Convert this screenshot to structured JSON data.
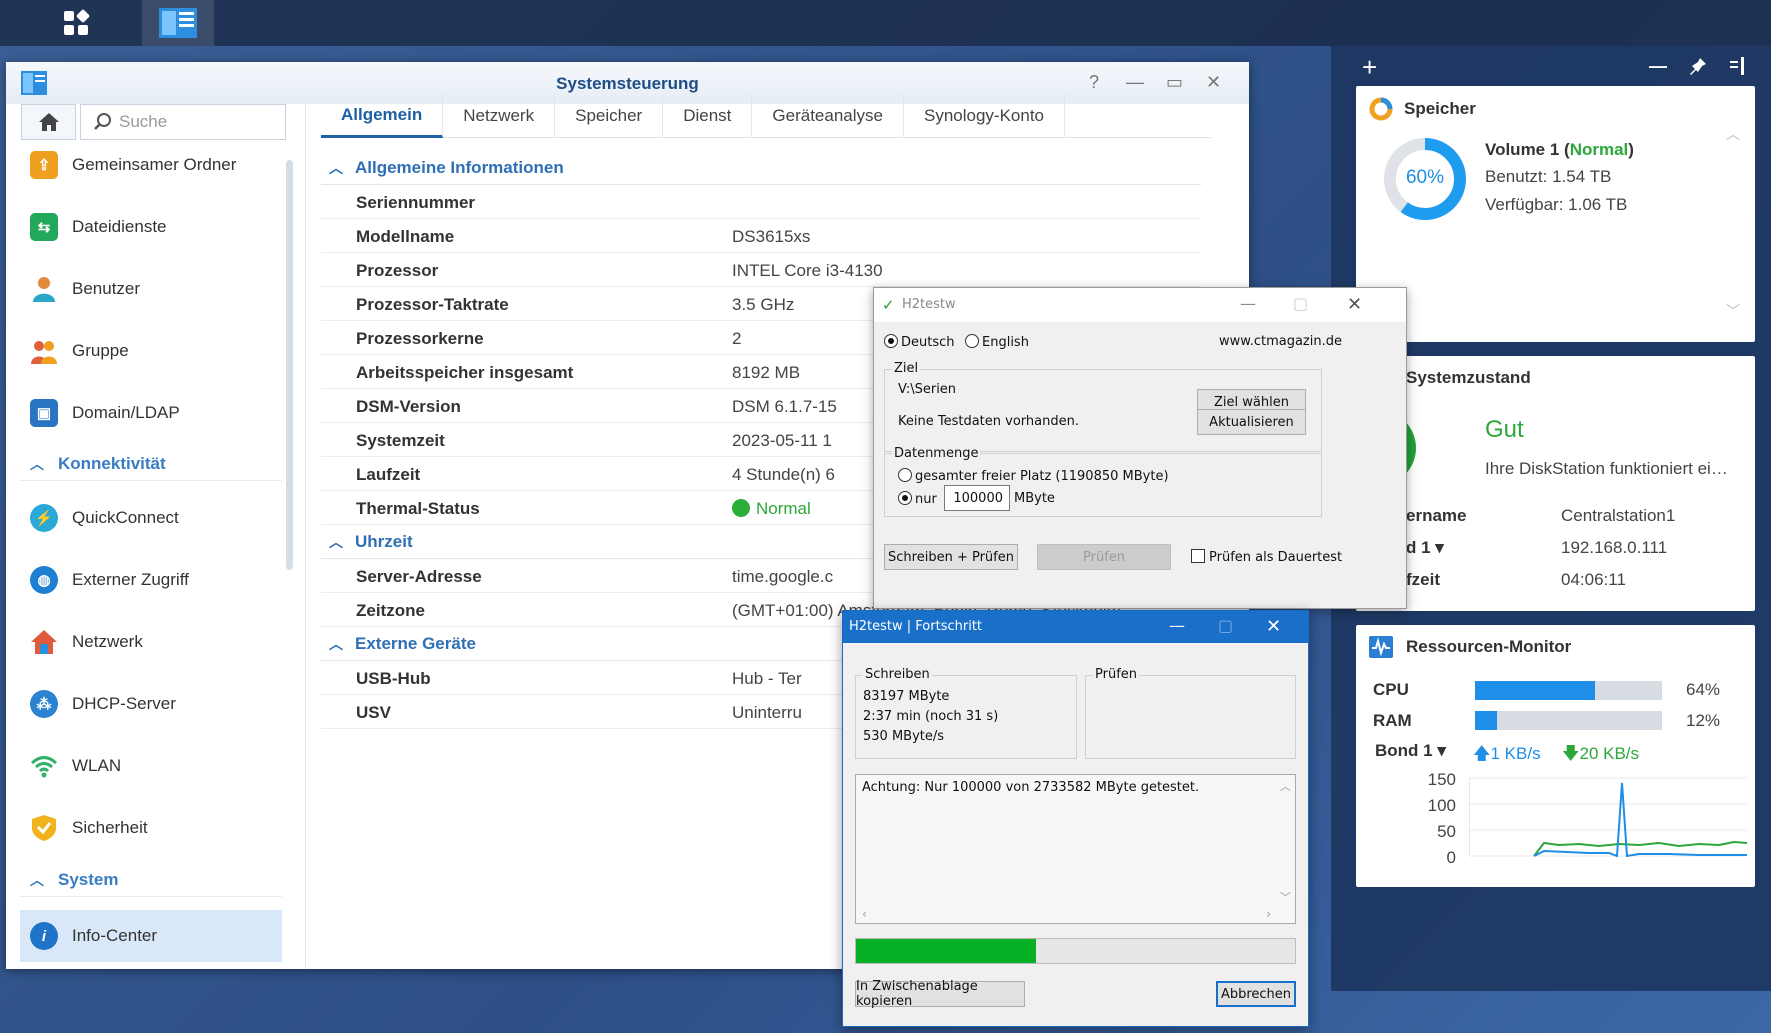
{
  "taskbar": {
    "main_menu_icon": "grid-icon",
    "app_icon": "control-panel-icon"
  },
  "window": {
    "title": "Systemsteuerung",
    "controls": {
      "help": "?",
      "minimize": "—",
      "maximize": "▭",
      "close": "✕"
    },
    "search_placeholder": "Suche",
    "sidebar": {
      "items_top": [
        {
          "label": "Gemeinsamer Ordner",
          "icon": "shared-folder-icon",
          "color": "#f0a020"
        },
        {
          "label": "Dateidienste",
          "icon": "file-services-icon",
          "color": "#22a85a"
        },
        {
          "label": "Benutzer",
          "icon": "user-icon",
          "color": "#e08a3c"
        },
        {
          "label": "Gruppe",
          "icon": "group-icon",
          "color": "#e0603c"
        },
        {
          "label": "Domain/LDAP",
          "icon": "domain-icon",
          "color": "#2a74c4"
        }
      ],
      "group_konnektivitaet": "Konnektivität",
      "items_conn": [
        {
          "label": "QuickConnect",
          "icon": "quickconnect-icon",
          "color": "#2aa8d8"
        },
        {
          "label": "Externer Zugriff",
          "icon": "globe-icon",
          "color": "#1f7fd0"
        },
        {
          "label": "Netzwerk",
          "icon": "network-home-icon",
          "color": "#e05a3c"
        },
        {
          "label": "DHCP-Server",
          "icon": "dhcp-icon",
          "color": "#2a82d0"
        },
        {
          "label": "WLAN",
          "icon": "wifi-icon",
          "color": "#2fb26a"
        },
        {
          "label": "Sicherheit",
          "icon": "shield-icon",
          "color": "#f2b21c"
        }
      ],
      "group_system": "System",
      "active_item": {
        "label": "Info-Center",
        "icon": "info-icon",
        "color": "#1f73c8"
      }
    },
    "tabs": [
      "Allgemein",
      "Netzwerk",
      "Speicher",
      "Dienst",
      "Geräteanalyse",
      "Synology-Konto"
    ],
    "sections": {
      "allgemein": "Allgemeine Informationen",
      "uhrzeit": "Uhrzeit",
      "extern": "Externe Geräte"
    },
    "general_rows": [
      {
        "k": "Seriennummer",
        "v": ""
      },
      {
        "k": "Modellname",
        "v": "DS3615xs"
      },
      {
        "k": "Prozessor",
        "v": "INTEL Core i3-4130"
      },
      {
        "k": "Prozessor-Taktrate",
        "v": "3.5 GHz"
      },
      {
        "k": "Prozessorkerne",
        "v": "2"
      },
      {
        "k": "Arbeitsspeicher insgesamt",
        "v": "8192 MB"
      },
      {
        "k": "DSM-Version",
        "v": "DSM 6.1.7-15"
      },
      {
        "k": "Systemzeit",
        "v": "2023-05-11 1"
      },
      {
        "k": "Laufzeit",
        "v": "4 Stunde(n) 6"
      },
      {
        "k": "Thermal-Status",
        "v": "Normal"
      }
    ],
    "time_rows": [
      {
        "k": "Server-Adresse",
        "v": "time.google.c"
      },
      {
        "k": "Zeitzone",
        "v": "(GMT+01:00) Amsterdam, Berlin, Rome, Stockholm"
      }
    ],
    "ext_rows": [
      {
        "k": "USB-Hub",
        "v": "Hub - Ter"
      },
      {
        "k": "USV",
        "v": "Uninterru"
      }
    ]
  },
  "widgets": {
    "toolbar": {
      "add": "+",
      "minimize": "—",
      "pin": "pin-icon",
      "collapse": "panel-icon"
    },
    "speicher": {
      "title": "Speicher",
      "percent": "60%",
      "percent_value": 60,
      "volume_label": "Volume 1 (",
      "volume_status": "Normal",
      "volume_close": ")",
      "used": "Benutzt: 1.54 TB",
      "free": "Verfügbar: 1.06 TB"
    },
    "systemzustand": {
      "title": "Systemzustand",
      "status": "Gut",
      "message": "Ihre DiskStation funktioniert ei…",
      "rows": [
        {
          "k": "ername",
          "v": "Centralstation1"
        },
        {
          "k": "d 1 ▾",
          "v": "192.168.0.111"
        },
        {
          "k": "fzeit",
          "v": "04:06:11"
        }
      ]
    },
    "ressourcen": {
      "title": "Ressourcen-Monitor",
      "cpu_label": "CPU",
      "cpu_pct": "64%",
      "cpu_value": 64,
      "ram_label": "RAM",
      "ram_pct": "12%",
      "ram_value": 12,
      "bond_label": "Bond 1 ▾",
      "up": "1 KB/s",
      "down": "20 KB/s",
      "y_ticks": [
        "150",
        "100",
        "50",
        "0"
      ]
    }
  },
  "h2testw": {
    "title": "H2testw",
    "lang_de": "Deutsch",
    "lang_en": "English",
    "site": "www.ctmagazin.de",
    "ziel_label": "Ziel",
    "ziel_path": "V:\\Serien",
    "ziel_btn": "Ziel wählen",
    "status": "Keine Testdaten vorhanden.",
    "refresh_btn": "Aktualisieren",
    "datenmenge_label": "Datenmenge",
    "opt_all": "gesamter freier Platz (1190850 MByte)",
    "opt_nur": "nur",
    "amount": "100000",
    "unit": "MByte",
    "btn_write": "Schreiben + Prüfen",
    "btn_check": "Prüfen",
    "chk_loop": "Prüfen als Dauertest"
  },
  "fortschritt": {
    "title": "H2testw | Fortschritt",
    "write_label": "Schreiben",
    "check_label": "Prüfen",
    "w1": "83197 MByte",
    "w2": "2:37 min (noch 31 s)",
    "w3": "530 MByte/s",
    "log": "Achtung: Nur 100000 von 2733582 MByte getestet.",
    "progress": 0.41,
    "btn_copy": "In Zwischenablage kopieren",
    "btn_cancel": "Abbrechen"
  }
}
